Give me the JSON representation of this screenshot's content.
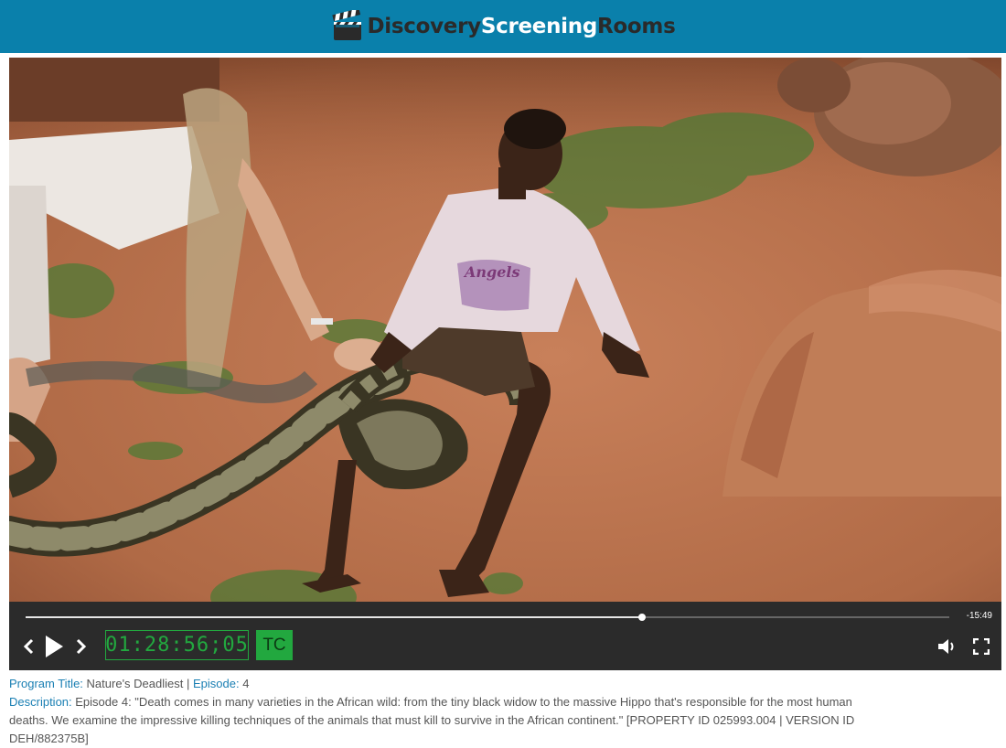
{
  "header": {
    "brand_part1": "Discovery",
    "brand_part2": "Screening",
    "brand_part3": "Rooms",
    "logo_icon": "clapperboard-icon"
  },
  "player": {
    "video_description_icon": "video-frame",
    "progress_fraction": 0.667,
    "time_remaining": "-15:49",
    "timecode": "01:28:56;05",
    "tc_label": "TC",
    "icons": {
      "prev": "chevron-left-icon",
      "play": "play-icon",
      "next": "chevron-right-icon",
      "volume": "volume-icon",
      "fullscreen": "fullscreen-icon"
    }
  },
  "info": {
    "program_title_label": "Program Title:",
    "program_title": "Nature's Deadliest",
    "separator": "|",
    "episode_label": "Episode:",
    "episode": "4",
    "description_label": "Description:",
    "description": "Episode 4: \"Death comes in many varieties in the African wild: from the tiny black widow to the massive Hippo that's responsible for the most human deaths. We examine the impressive killing techniques of the animals that must kill to survive in the African continent.\" [PROPERTY ID 025993.004 | VERSION ID DEH/882375B]"
  },
  "colors": {
    "header_bg": "#0a80ab",
    "timecode_green": "#22a83f",
    "label_blue": "#1a7fb3",
    "controls_bg": "#2b2b2b"
  }
}
